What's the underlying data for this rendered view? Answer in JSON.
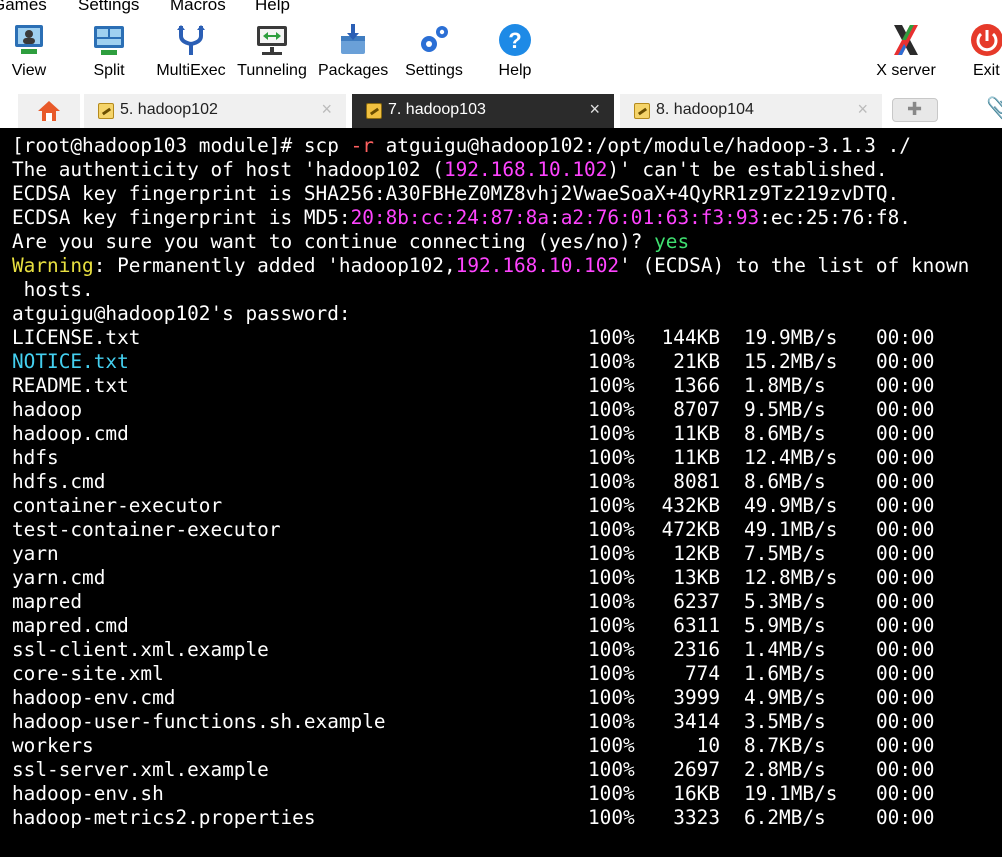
{
  "menu": [
    "Games",
    "Settings",
    "Macros",
    "Help"
  ],
  "toolbar": {
    "items": [
      {
        "label": "View",
        "icon": "view-icon"
      },
      {
        "label": "Split",
        "icon": "split-icon"
      },
      {
        "label": "MultiExec",
        "icon": "multiexec-icon"
      },
      {
        "label": "Tunneling",
        "icon": "tunneling-icon"
      },
      {
        "label": "Packages",
        "icon": "packages-icon"
      },
      {
        "label": "Settings",
        "icon": "settings-icon"
      },
      {
        "label": "Help",
        "icon": "help-icon"
      },
      {
        "label": "X server",
        "icon": "x-server-icon"
      },
      {
        "label": "Exit",
        "icon": "exit-icon"
      }
    ]
  },
  "tabs": [
    {
      "label": "5. hadoop102",
      "close": "×"
    },
    {
      "label": "7. hadoop103",
      "close": "×"
    },
    {
      "label": "8. hadoop104",
      "close": "×"
    }
  ],
  "terminal": {
    "cmd": {
      "prompt": "[root@hadoop103 module]# scp ",
      "flag": "-r",
      "rest": " atguigu@hadoop102:/opt/module/hadoop-3.1.3 ./"
    },
    "auth": {
      "pre": "The authenticity of host 'hadoop102 (",
      "ip": "192.168.10.102",
      "post": ")' can't be established."
    },
    "sha": "ECDSA key fingerprint is SHA256:A30FBHeZ0MZ8vhj2VwaeSoaX+4QyRR1z9Tz219zvDTQ.",
    "md5": {
      "pre": "ECDSA key fingerprint is MD5:",
      "hex1": "20:8b:cc:24:87:8a",
      "sep1": ":",
      "hex2": "a2:76:01:63:f3:93",
      "post": ":ec:25:76:f8."
    },
    "confirm": {
      "pre": "Are you sure you want to continue connecting (yes/no)? ",
      "answer": "yes"
    },
    "warning": {
      "label": "Warning",
      "pre": ": Permanently added 'hadoop102,",
      "ip": "192.168.10.102",
      "post": "' (ECDSA) to the list of known",
      "wrap": " hosts."
    },
    "password": "atguigu@hadoop102's password:",
    "files": [
      {
        "name": "LICENSE.txt",
        "pct": "100%",
        "size": "144KB",
        "speed": "19.9MB/s",
        "eta": "00:00"
      },
      {
        "name": "NOTICE.txt",
        "pct": "100%",
        "size": "21KB",
        "speed": "15.2MB/s",
        "eta": "00:00"
      },
      {
        "name": "README.txt",
        "pct": "100%",
        "size": "1366",
        "speed": "1.8MB/s",
        "eta": "00:00"
      },
      {
        "name": "hadoop",
        "pct": "100%",
        "size": "8707",
        "speed": "9.5MB/s",
        "eta": "00:00"
      },
      {
        "name": "hadoop.cmd",
        "pct": "100%",
        "size": "11KB",
        "speed": "8.6MB/s",
        "eta": "00:00"
      },
      {
        "name": "hdfs",
        "pct": "100%",
        "size": "11KB",
        "speed": "12.4MB/s",
        "eta": "00:00"
      },
      {
        "name": "hdfs.cmd",
        "pct": "100%",
        "size": "8081",
        "speed": "8.6MB/s",
        "eta": "00:00"
      },
      {
        "name": "container-executor",
        "pct": "100%",
        "size": "432KB",
        "speed": "49.9MB/s",
        "eta": "00:00"
      },
      {
        "name": "test-container-executor",
        "pct": "100%",
        "size": "472KB",
        "speed": "49.1MB/s",
        "eta": "00:00"
      },
      {
        "name": "yarn",
        "pct": "100%",
        "size": "12KB",
        "speed": "7.5MB/s",
        "eta": "00:00"
      },
      {
        "name": "yarn.cmd",
        "pct": "100%",
        "size": "13KB",
        "speed": "12.8MB/s",
        "eta": "00:00"
      },
      {
        "name": "mapred",
        "pct": "100%",
        "size": "6237",
        "speed": "5.3MB/s",
        "eta": "00:00"
      },
      {
        "name": "mapred.cmd",
        "pct": "100%",
        "size": "6311",
        "speed": "5.9MB/s",
        "eta": "00:00"
      },
      {
        "name": "ssl-client.xml.example",
        "pct": "100%",
        "size": "2316",
        "speed": "1.4MB/s",
        "eta": "00:00"
      },
      {
        "name": "core-site.xml",
        "pct": "100%",
        "size": "774",
        "speed": "1.6MB/s",
        "eta": "00:00"
      },
      {
        "name": "hadoop-env.cmd",
        "pct": "100%",
        "size": "3999",
        "speed": "4.9MB/s",
        "eta": "00:00"
      },
      {
        "name": "hadoop-user-functions.sh.example",
        "pct": "100%",
        "size": "3414",
        "speed": "3.5MB/s",
        "eta": "00:00"
      },
      {
        "name": "workers",
        "pct": "100%",
        "size": "10",
        "speed": "8.7KB/s",
        "eta": "00:00"
      },
      {
        "name": "ssl-server.xml.example",
        "pct": "100%",
        "size": "2697",
        "speed": "2.8MB/s",
        "eta": "00:00"
      },
      {
        "name": "hadoop-env.sh",
        "pct": "100%",
        "size": "16KB",
        "speed": "19.1MB/s",
        "eta": "00:00"
      },
      {
        "name": "hadoop-metrics2.properties",
        "pct": "100%",
        "size": "3323",
        "speed": "6.2MB/s",
        "eta": "00:00"
      }
    ]
  },
  "colors": {
    "terminal_bg": "#000000",
    "ip": "#ff44ff",
    "answer": "#3fe070",
    "warning": "#e8e040",
    "dir_name": "#44d0f0",
    "active_tab": "#2b2b2b"
  }
}
